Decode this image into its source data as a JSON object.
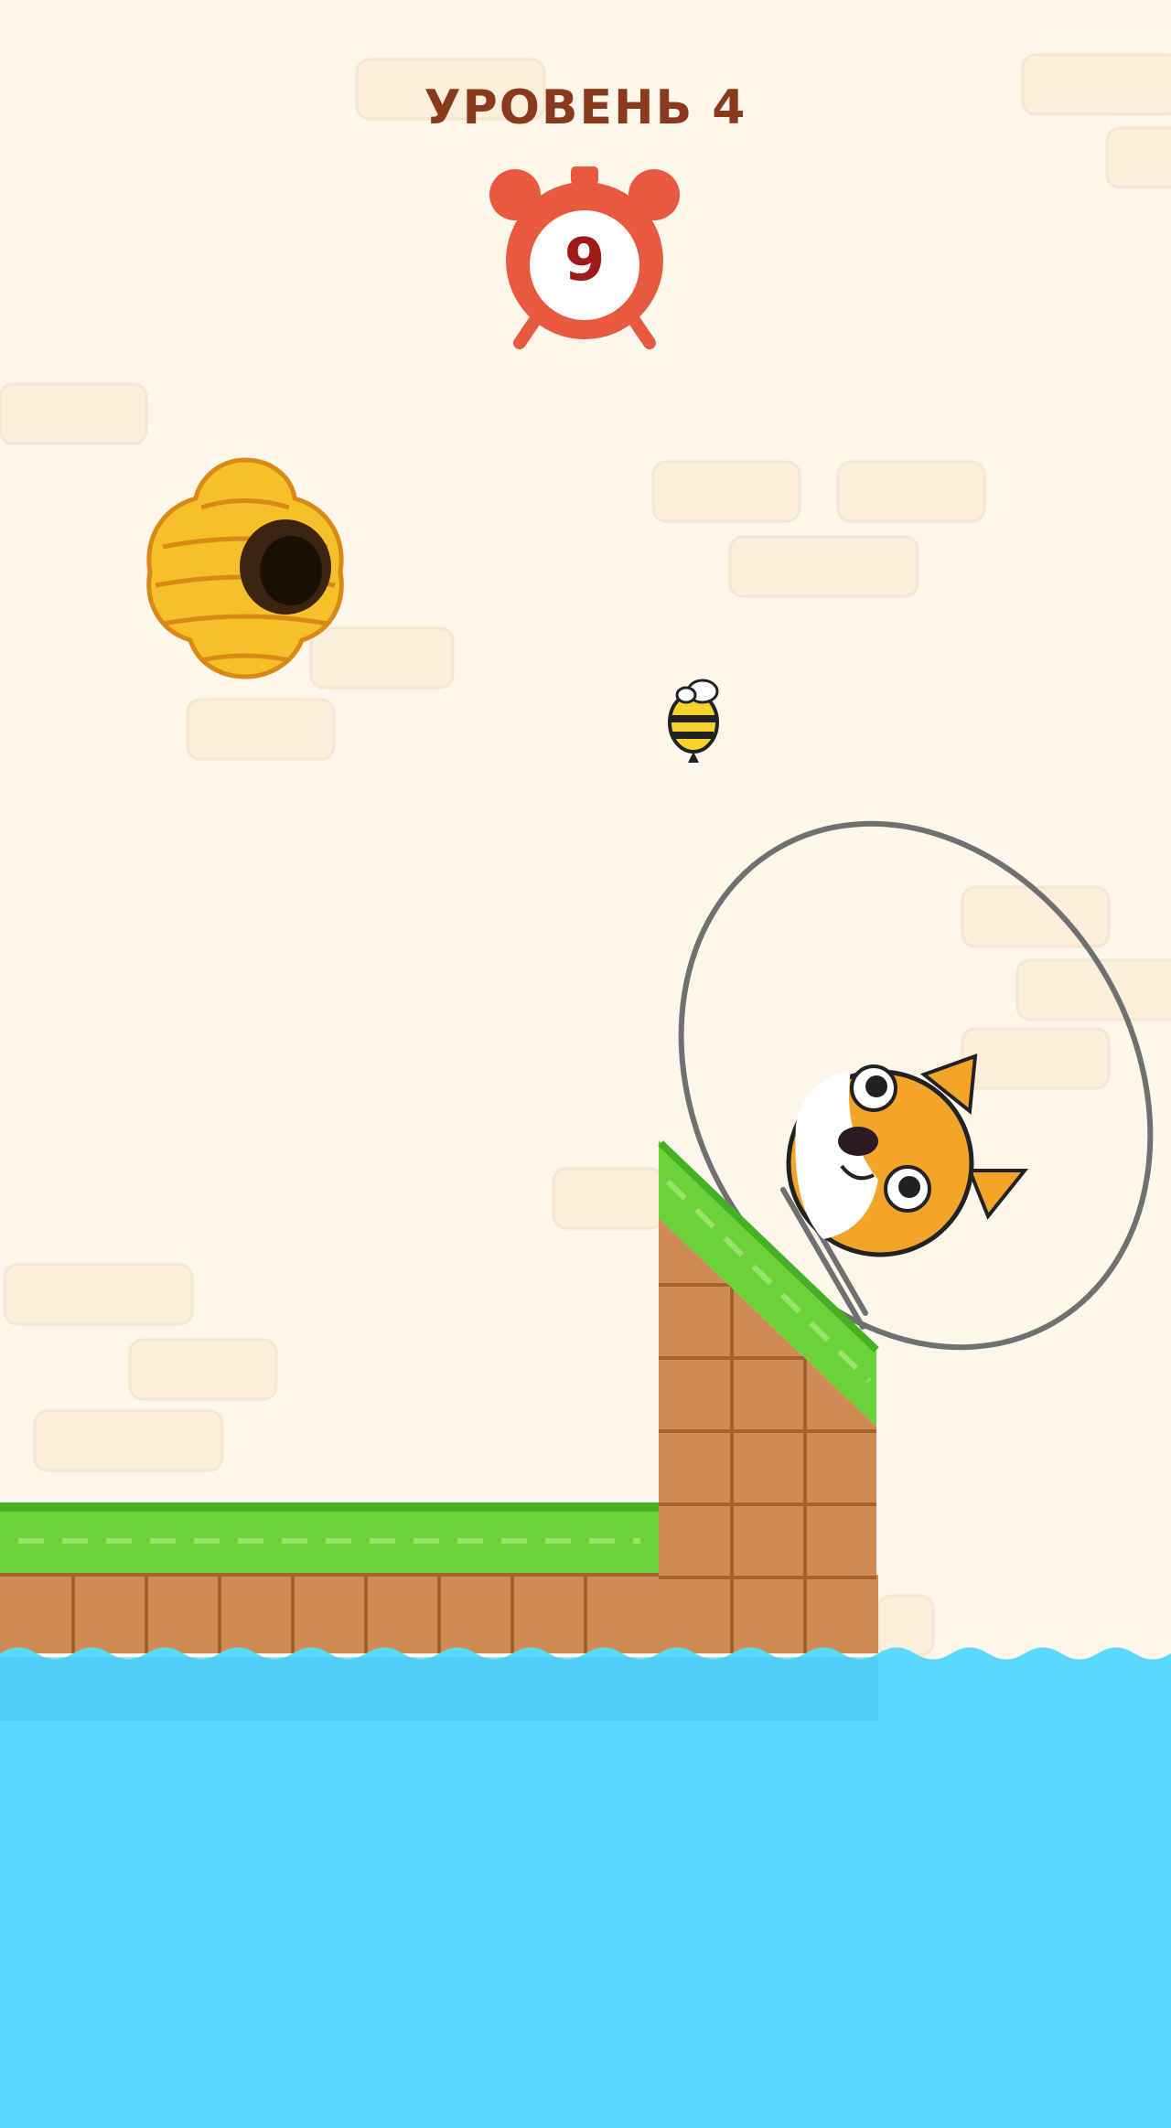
{
  "hud": {
    "level_label": "УРОВЕНЬ 4",
    "timer_value": "9",
    "timer_icon": "alarm-clock-icon"
  },
  "scene": {
    "characters": [
      "shiba-dog",
      "bee"
    ],
    "objects": [
      "beehive",
      "drawn-shield-line",
      "grass-ground",
      "grass-ramp",
      "water"
    ],
    "colors": {
      "background": "#fdf6ea",
      "grass": "#6cd23c",
      "dirt": "#d18b52",
      "water": "#5ad8ff",
      "timer": "#e85a40",
      "title": "#8a3a1c"
    }
  }
}
